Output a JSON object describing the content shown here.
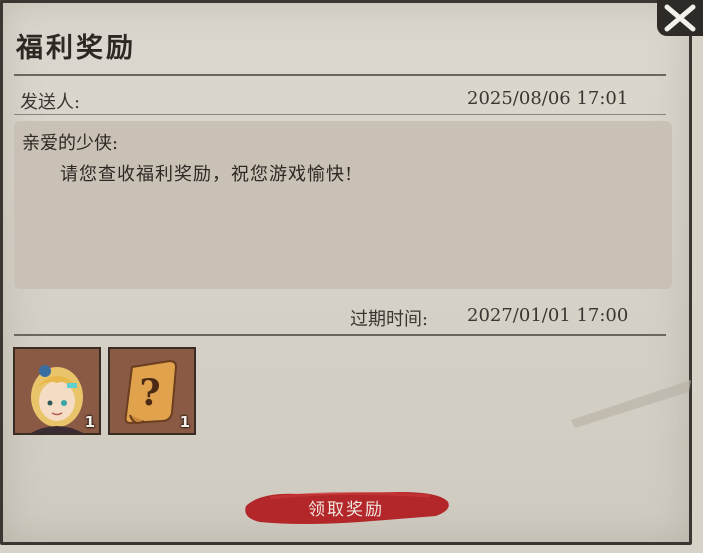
{
  "mail": {
    "title": "福利奖励",
    "sender_label": "发送人:",
    "sent_time": "2025/08/06 17:01",
    "greeting": "亲爱的少侠:",
    "message": "请您查收福利奖励，祝您游戏愉快!",
    "expiry_label": "过期时间:",
    "expiry_time": "2027/01/01 17:00"
  },
  "rewards": [
    {
      "icon": "hero-portrait-icon",
      "count": "1"
    },
    {
      "icon": "mystery-scroll-icon",
      "count": "1"
    }
  ],
  "actions": {
    "claim_label": "领取奖励"
  },
  "colors": {
    "panel": "#d8d3c9",
    "body_box": "#c9c1b6",
    "claim_button": "#b3262a",
    "slot_frame": "#7a4f3a"
  }
}
